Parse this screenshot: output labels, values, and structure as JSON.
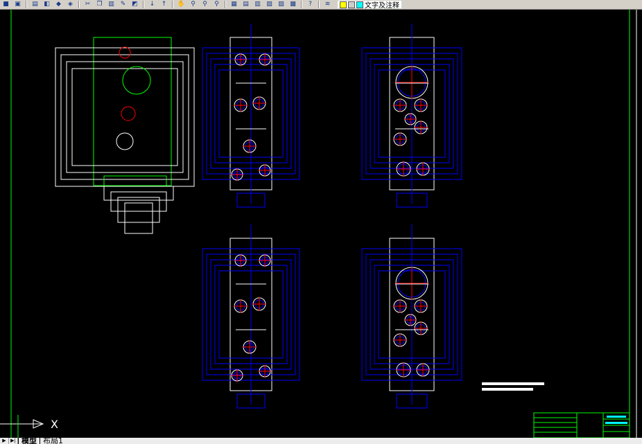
{
  "toolbar": {
    "icons": [
      "open-icon",
      "save-icon",
      "print-icon",
      "preview-icon",
      "publish-icon",
      "3d-dwf-icon",
      "cut-icon",
      "copy-icon",
      "paste-icon",
      "match-properties-icon",
      "block-editor-icon",
      "undo-icon",
      "redo-icon",
      "pan-icon",
      "zoom-realtime-icon",
      "zoom-window-icon",
      "zoom-previous-icon",
      "properties-icon",
      "design-center-icon",
      "tool-palettes-icon",
      "sheet-set-icon",
      "markup-icon",
      "quickcalc-icon",
      "help-icon"
    ],
    "layer_manager_icon": "layer-manager-icon",
    "current_layer": "文字及注释",
    "layer_color": "#00ffff"
  },
  "tabs": {
    "items": [
      "模型",
      "布局1"
    ]
  },
  "ucs": {
    "x_label": "X"
  },
  "colors": {
    "border": "#00ff00",
    "dim": "#0000ff",
    "outline": "#ffffff",
    "center": "#ff0000",
    "text": "#00ffff"
  }
}
